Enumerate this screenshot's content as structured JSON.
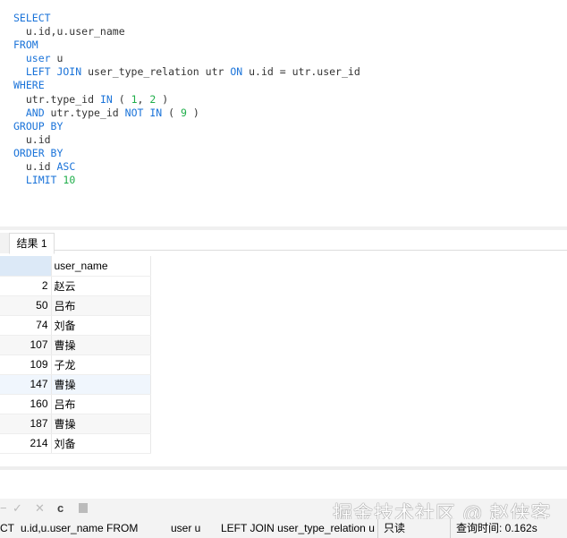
{
  "sql": {
    "l1": "SELECT",
    "l2": "  u.id,u.user_name",
    "l3": "FROM",
    "l4a": "  user",
    "l4b": " u",
    "l5a": "  LEFT JOIN",
    "l5b": " user_type_relation utr ",
    "l5c": "ON",
    "l5d": " u.id = utr.user_id",
    "l6": "WHERE",
    "l7a": "  utr.type_id ",
    "l7b": "IN",
    "l7c": " ( ",
    "l7d": "1",
    "l7e": ", ",
    "l7f": "2",
    "l7g": " )",
    "l8a": "  AND",
    "l8b": " utr.type_id ",
    "l8c": "NOT IN",
    "l8d": " ( ",
    "l8e": "9",
    "l8f": " )",
    "l9": "GROUP BY",
    "l10": "  u.id",
    "l11": "ORDER BY",
    "l12a": "  u.id ",
    "l12b": "ASC",
    "l13a": "  LIMIT ",
    "l13b": "10"
  },
  "tabs": [
    {
      "label": "结果 1"
    }
  ],
  "table": {
    "columns": [
      "",
      "user_name"
    ],
    "rows": [
      [
        "2",
        "赵云"
      ],
      [
        "50",
        "吕布"
      ],
      [
        "74",
        "刘备"
      ],
      [
        "107",
        "曹操"
      ],
      [
        "109",
        "子龙"
      ],
      [
        "147",
        "曹操"
      ],
      [
        "160",
        "吕布"
      ],
      [
        "187",
        "曹操"
      ],
      [
        "214",
        "刘备"
      ]
    ]
  },
  "toolbar": {
    "icons": [
      "minus-icon",
      "check-icon",
      "x-icon",
      "refresh-icon",
      "stop-icon"
    ]
  },
  "status": {
    "s1": "CT",
    "s2": "u.id,u.user_name FROM",
    "s3": "user u",
    "s4": "LEFT JOIN user_type_relation u",
    "s5": "只读",
    "s6": "查询时间: 0.162s"
  },
  "watermark": "掘金技术社区 @ 赵侠客"
}
